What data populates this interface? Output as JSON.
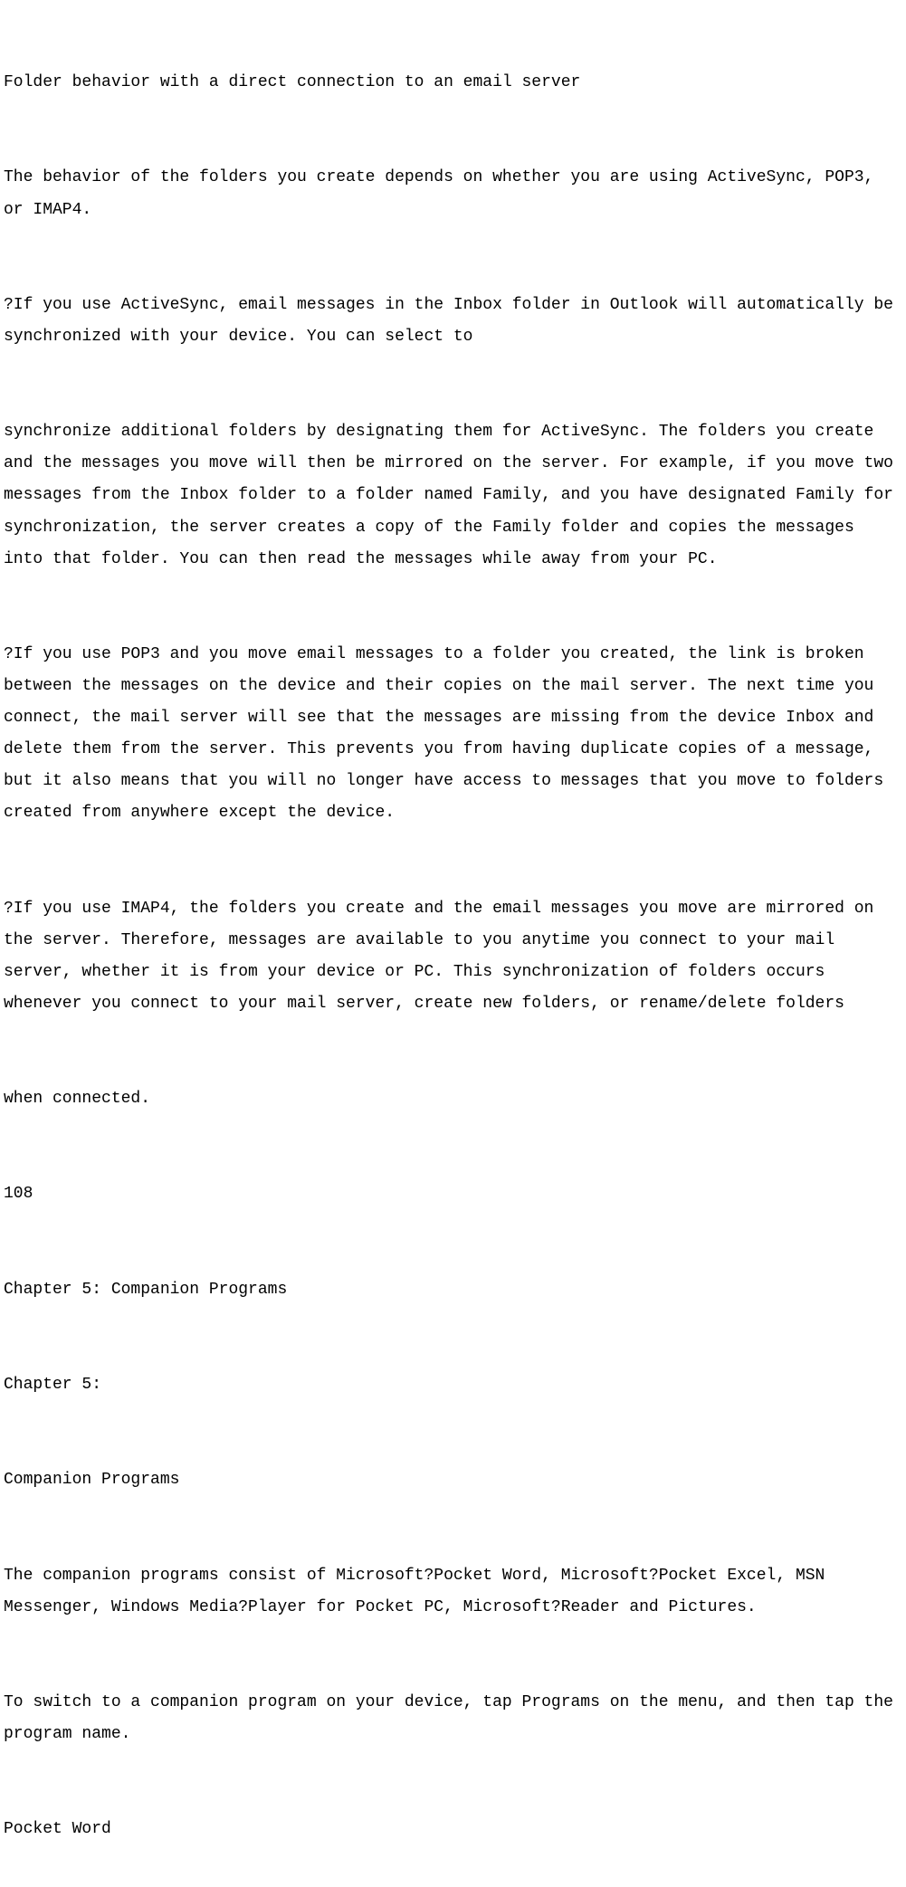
{
  "lines": [
    "Folder behavior with a direct connection to an email server",
    "The behavior of the folders you create depends on whether you are using ActiveSync, POP3, or IMAP4.",
    "?If you use ActiveSync, email messages in the Inbox folder in Outlook will automatically be synchronized with your device. You can select to",
    "synchronize additional folders by designating them for ActiveSync. The folders you create and the messages you move will then be mirrored on the server. For example, if you move two messages from the Inbox folder to a folder named Family, and you have designated Family for synchronization, the server creates a copy of the Family folder and copies the messages into that folder. You can then read the messages while away from your PC.",
    "?If you use POP3 and you move email messages to a folder you created, the link is broken between the messages on the device and their copies on the mail server. The next time you connect, the mail server will see that the messages are missing from the device Inbox and delete them from the server. This prevents you from having duplicate copies of a message, but it also means that you will no longer have access to messages that you move to folders created from anywhere except the device.",
    "?If you use IMAP4, the folders you create and the email messages you move are mirrored on the server. Therefore, messages are available to you anytime you connect to your mail server, whether it is from your device or PC. This synchronization of folders occurs whenever you connect to your mail server, create new folders, or rename/delete folders",
    "when connected.",
    "108",
    "Chapter 5: Companion Programs",
    "Chapter 5:",
    "Companion Programs",
    "The companion programs consist of Microsoft?Pocket Word, Microsoft?Pocket Excel, MSN Messenger, Windows Media?Player for Pocket PC, Microsoft?Reader and Pictures.",
    "To switch to a companion program on your device, tap Programs on the menu, and then tap the program name.",
    "Pocket Word"
  ]
}
